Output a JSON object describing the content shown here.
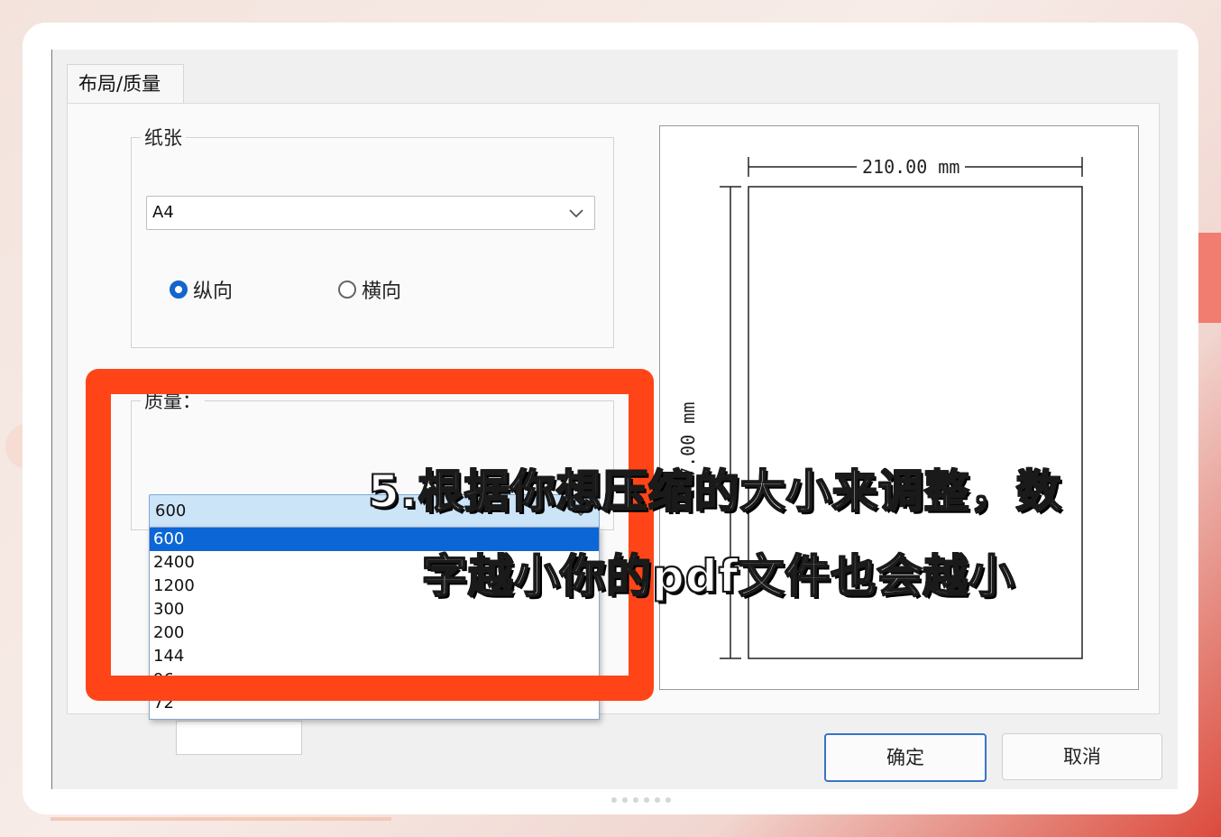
{
  "tab": {
    "label": "布局/质量"
  },
  "paper": {
    "group_label": "纸张",
    "size_value": "A4",
    "orientation": [
      {
        "label": "纵向",
        "selected": true
      },
      {
        "label": "横向",
        "selected": false
      }
    ]
  },
  "quality": {
    "group_label": "质量：",
    "current_value": "600",
    "options": [
      "600",
      "2400",
      "1200",
      "300",
      "200",
      "144",
      "96",
      "72"
    ],
    "selected_index": 0
  },
  "preview": {
    "width_label": "210.00 mm",
    "height_label": "297.00 mm"
  },
  "buttons": {
    "ok": "确定",
    "cancel": "取消"
  },
  "caption": {
    "line1": "5.根据你想压缩的大小来调整，数",
    "line2": "字越小你的pdf文件也会越小"
  },
  "colors": {
    "highlight": "#ff4517",
    "accent": "#0c66d6"
  }
}
